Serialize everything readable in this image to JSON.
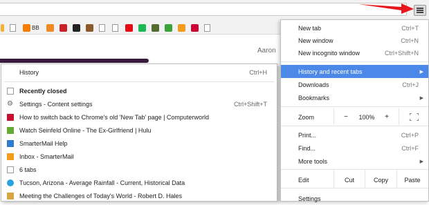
{
  "app": {
    "accent": "#4b88e8",
    "arrow_color": "#e8171b"
  },
  "toolbar": {
    "menu_icon": "hamburger-icon"
  },
  "bookmarks": [
    {
      "name": "bm-folder",
      "color": "#f2b233",
      "text": ""
    },
    {
      "name": "bm-page",
      "color": "",
      "text": ""
    },
    {
      "name": "bm-blogger",
      "color": "#f57d00",
      "text": "BB"
    },
    {
      "name": "bm-orange-circle",
      "color": "#f08a24",
      "text": ""
    },
    {
      "name": "bm-pinterest",
      "color": "#cb2027",
      "text": ""
    },
    {
      "name": "bm-amazon",
      "color": "#222222",
      "text": ""
    },
    {
      "name": "bm-brown",
      "color": "#8b5a2b",
      "text": ""
    },
    {
      "name": "bm-page2",
      "color": "",
      "text": ""
    },
    {
      "name": "bm-page3",
      "color": "",
      "text": ""
    },
    {
      "name": "bm-netflix",
      "color": "#e50914",
      "text": ""
    },
    {
      "name": "bm-spotify",
      "color": "#1db954",
      "text": ""
    },
    {
      "name": "bm-bird",
      "color": "#556b2f",
      "text": ""
    },
    {
      "name": "bm-up",
      "color": "#3aa33a",
      "text": ""
    },
    {
      "name": "bm-mail",
      "color": "#f29b1d",
      "text": ""
    },
    {
      "name": "bm-arizona",
      "color": "#cc0033",
      "text": ""
    },
    {
      "name": "bm-page4",
      "color": "",
      "text": ""
    }
  ],
  "page": {
    "partial_name": "Aaron"
  },
  "history_menu": {
    "header": {
      "label": "History",
      "shortcut": "Ctrl+H"
    },
    "recently_closed": "Recently closed",
    "items": [
      {
        "label": "Settings - Content settings",
        "shortcut": "Ctrl+Shift+T",
        "icon": "gear-icon",
        "color": "#666666"
      },
      {
        "label": "How to switch back to Chrome's old 'New Tab' page | Computerworld",
        "shortcut": "",
        "icon": "computerworld-icon",
        "color": "#c8102e"
      },
      {
        "label": "Watch Seinfeld Online - The Ex-Girlfriend | Hulu",
        "shortcut": "",
        "icon": "hulu-icon",
        "color": "#66aa33"
      },
      {
        "label": "SmarterMail Help",
        "shortcut": "",
        "icon": "help-icon",
        "color": "#2e7bcf"
      },
      {
        "label": "Inbox - SmarterMail",
        "shortcut": "",
        "icon": "mail-icon",
        "color": "#f29b1d"
      },
      {
        "label": "6 tabs",
        "shortcut": "",
        "icon": "tabs-icon",
        "color": ""
      },
      {
        "label": "Tucson, Arizona - Average Rainfall - Current, Historical Data",
        "shortcut": "",
        "icon": "weather-icon",
        "color": "#29a3e0"
      },
      {
        "label": "Meeting the Challenges of Today's World - Robert D. Hales",
        "shortcut": "",
        "icon": "lds-icon",
        "color": "#d9a441"
      }
    ]
  },
  "main_menu": {
    "new_tab": {
      "label": "New tab",
      "shortcut": "Ctrl+T"
    },
    "new_window": {
      "label": "New window",
      "shortcut": "Ctrl+N"
    },
    "new_incognito": {
      "label": "New incognito window",
      "shortcut": "Ctrl+Shift+N"
    },
    "history": {
      "label": "History and recent tabs"
    },
    "downloads": {
      "label": "Downloads",
      "shortcut": "Ctrl+J"
    },
    "bookmarks": {
      "label": "Bookmarks"
    },
    "zoom": {
      "label": "Zoom",
      "minus": "−",
      "value": "100%",
      "plus": "+"
    },
    "print": {
      "label": "Print...",
      "shortcut": "Ctrl+P"
    },
    "find": {
      "label": "Find...",
      "shortcut": "Ctrl+F"
    },
    "more_tools": {
      "label": "More tools"
    },
    "edit": {
      "label": "Edit",
      "cut": "Cut",
      "copy": "Copy",
      "paste": "Paste"
    },
    "settings": {
      "label": "Settings"
    }
  }
}
